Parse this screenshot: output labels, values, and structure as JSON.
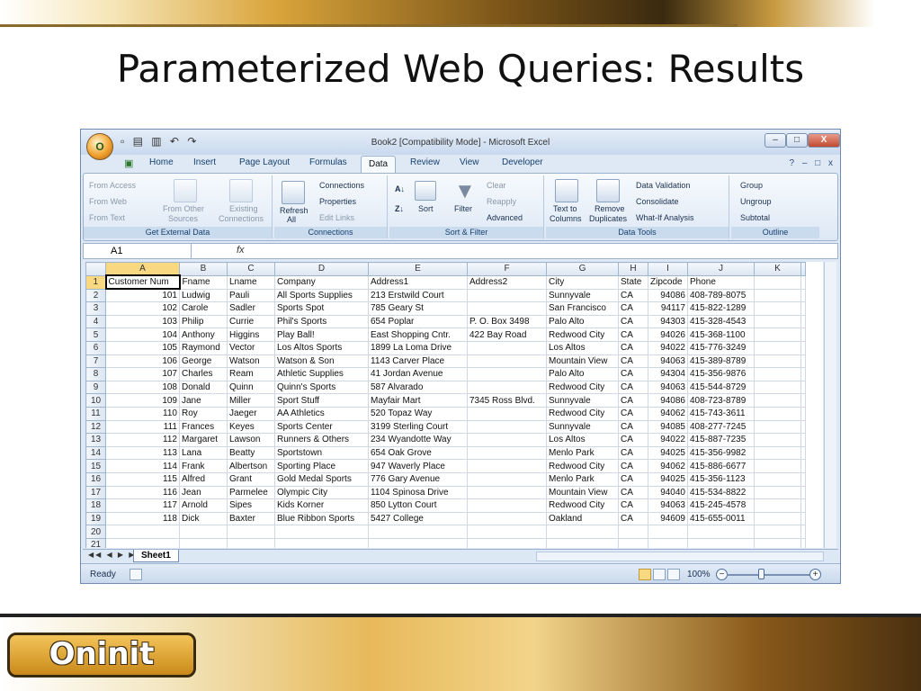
{
  "slide": {
    "title": "Parameterized Web Queries: Results",
    "logo": "Oninit"
  },
  "window": {
    "title": "Book2  [Compatibility Mode] - Microsoft Excel",
    "orb": "O",
    "minimize": "–",
    "maximize": "□",
    "close": "X"
  },
  "tabs": [
    "Home",
    "Insert",
    "Page Layout",
    "Formulas",
    "Data",
    "Review",
    "View",
    "Developer"
  ],
  "active_tab": "Data",
  "ribbon": {
    "get_external": {
      "label": "Get External Data",
      "from_access": "From Access",
      "from_web": "From Web",
      "from_text": "From Text",
      "from_other": "From Other",
      "sources": "Sources",
      "existing": "Existing",
      "connections": "Connections"
    },
    "connections": {
      "label": "Connections",
      "refresh": "Refresh",
      "all": "All",
      "connections": "Connections",
      "properties": "Properties",
      "edit_links": "Edit Links"
    },
    "sort_filter": {
      "label": "Sort & Filter",
      "sort": "Sort",
      "filter": "Filter",
      "clear": "Clear",
      "reapply": "Reapply",
      "advanced": "Advanced",
      "az": "A↓",
      "za": "Z↓"
    },
    "data_tools": {
      "label": "Data Tools",
      "text_to": "Text to",
      "columns": "Columns",
      "remove": "Remove",
      "duplicates": "Duplicates",
      "validation": "Data Validation",
      "consolidate": "Consolidate",
      "whatif": "What-If Analysis"
    },
    "outline": {
      "label": "Outline",
      "group": "Group",
      "ungroup": "Ungroup",
      "subtotal": "Subtotal"
    }
  },
  "formula_bar": {
    "name_box": "A1",
    "fx": "fx"
  },
  "columns": [
    "A",
    "B",
    "C",
    "D",
    "E",
    "F",
    "G",
    "H",
    "I",
    "J",
    "K"
  ],
  "rows": [
    [
      "Customer Num",
      "Fname",
      "Lname",
      "Company",
      "Address1",
      "Address2",
      "City",
      "State",
      "Zipcode",
      "Phone",
      ""
    ],
    [
      "101",
      "Ludwig",
      "Pauli",
      "All Sports Supplies",
      "213 Erstwild Court",
      "",
      "Sunnyvale",
      "CA",
      "94086",
      "408-789-8075",
      ""
    ],
    [
      "102",
      "Carole",
      "Sadler",
      "Sports Spot",
      "785 Geary St",
      "",
      "San Francisco",
      "CA",
      "94117",
      "415-822-1289",
      ""
    ],
    [
      "103",
      "Philip",
      "Currie",
      "Phil's Sports",
      "654 Poplar",
      "P. O. Box 3498",
      "Palo Alto",
      "CA",
      "94303",
      "415-328-4543",
      ""
    ],
    [
      "104",
      "Anthony",
      "Higgins",
      "Play Ball!",
      "East Shopping Cntr.",
      "422 Bay Road",
      "Redwood City",
      "CA",
      "94026",
      "415-368-1100",
      ""
    ],
    [
      "105",
      "Raymond",
      "Vector",
      "Los Altos Sports",
      "1899 La Loma Drive",
      "",
      "Los Altos",
      "CA",
      "94022",
      "415-776-3249",
      ""
    ],
    [
      "106",
      "George",
      "Watson",
      "Watson & Son",
      "1143 Carver Place",
      "",
      "Mountain View",
      "CA",
      "94063",
      "415-389-8789",
      ""
    ],
    [
      "107",
      "Charles",
      "Ream",
      "Athletic Supplies",
      "41 Jordan Avenue",
      "",
      "Palo Alto",
      "CA",
      "94304",
      "415-356-9876",
      ""
    ],
    [
      "108",
      "Donald",
      "Quinn",
      "Quinn's Sports",
      "587 Alvarado",
      "",
      "Redwood City",
      "CA",
      "94063",
      "415-544-8729",
      ""
    ],
    [
      "109",
      "Jane",
      "Miller",
      "Sport Stuff",
      "Mayfair Mart",
      "7345 Ross Blvd.",
      "Sunnyvale",
      "CA",
      "94086",
      "408-723-8789",
      ""
    ],
    [
      "110",
      "Roy",
      "Jaeger",
      "AA Athletics",
      "520 Topaz Way",
      "",
      "Redwood City",
      "CA",
      "94062",
      "415-743-3611",
      ""
    ],
    [
      "111",
      "Frances",
      "Keyes",
      "Sports Center",
      "3199 Sterling Court",
      "",
      "Sunnyvale",
      "CA",
      "94085",
      "408-277-7245",
      ""
    ],
    [
      "112",
      "Margaret",
      "Lawson",
      "Runners & Others",
      "234 Wyandotte Way",
      "",
      "Los Altos",
      "CA",
      "94022",
      "415-887-7235",
      ""
    ],
    [
      "113",
      "Lana",
      "Beatty",
      "Sportstown",
      "654 Oak Grove",
      "",
      "Menlo Park",
      "CA",
      "94025",
      "415-356-9982",
      ""
    ],
    [
      "114",
      "Frank",
      "Albertson",
      "Sporting Place",
      "947 Waverly Place",
      "",
      "Redwood City",
      "CA",
      "94062",
      "415-886-6677",
      ""
    ],
    [
      "115",
      "Alfred",
      "Grant",
      "Gold Medal Sports",
      "776 Gary Avenue",
      "",
      "Menlo Park",
      "CA",
      "94025",
      "415-356-1123",
      ""
    ],
    [
      "116",
      "Jean",
      "Parmelee",
      "Olympic City",
      "1104 Spinosa Drive",
      "",
      "Mountain View",
      "CA",
      "94040",
      "415-534-8822",
      ""
    ],
    [
      "117",
      "Arnold",
      "Sipes",
      "Kids Korner",
      "850 Lytton Court",
      "",
      "Redwood City",
      "CA",
      "94063",
      "415-245-4578",
      ""
    ],
    [
      "118",
      "Dick",
      "Baxter",
      "Blue Ribbon Sports",
      "5427 College",
      "",
      "Oakland",
      "CA",
      "94609",
      "415-655-0011",
      ""
    ],
    [
      "",
      "",
      "",
      "",
      "",
      "",
      "",
      "",
      "",
      "",
      ""
    ],
    [
      "",
      "",
      "",
      "",
      "",
      "",
      "",
      "",
      "",
      "",
      ""
    ]
  ],
  "sheet_tab": "Sheet1",
  "status": {
    "ready": "Ready",
    "zoom": "100%",
    "zoom_out": "−",
    "zoom_in": "+"
  }
}
